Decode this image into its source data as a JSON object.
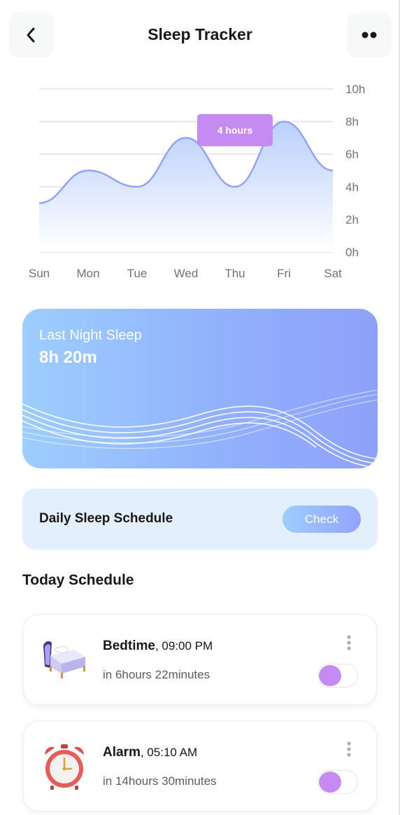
{
  "header": {
    "title": "Sleep Tracker",
    "back_icon": "chevron-left-icon",
    "more_icon": "more-dots-icon"
  },
  "chart_data": {
    "type": "area",
    "categories": [
      "Sun",
      "Mon",
      "Tue",
      "Wed",
      "Thu",
      "Fri",
      "Sat"
    ],
    "values": [
      3,
      5,
      4,
      7,
      4,
      8,
      5
    ],
    "y_ticks": [
      "0h",
      "2h",
      "4h",
      "6h",
      "8h",
      "10h"
    ],
    "ylim": [
      0,
      10
    ],
    "grid": true,
    "tooltip": {
      "label": "4 hours",
      "category": "Thu"
    },
    "colors": {
      "line": "#92a3fd",
      "fill_top": "#b7cdfc",
      "tooltip": "#c58bf2"
    }
  },
  "last_night": {
    "label": "Last Night Sleep",
    "value": "8h 20m"
  },
  "daily_schedule": {
    "title": "Daily Sleep Schedule",
    "button": "Check"
  },
  "today_schedule": {
    "title": "Today Schedule",
    "items": [
      {
        "name": "Bedtime",
        "time": ", 09:00 PM",
        "remaining": "in 6hours 22minutes",
        "icon": "bed-icon",
        "enabled": false
      },
      {
        "name": "Alarm",
        "time": ", 05:10 AM",
        "remaining": "in 14hours 30minutes",
        "icon": "alarm-clock-icon",
        "enabled": false
      }
    ]
  },
  "colors": {
    "accent": "#c58bf2",
    "blue_light": "#9dcefe",
    "blue": "#92a3fd",
    "text": "#1d1617"
  }
}
